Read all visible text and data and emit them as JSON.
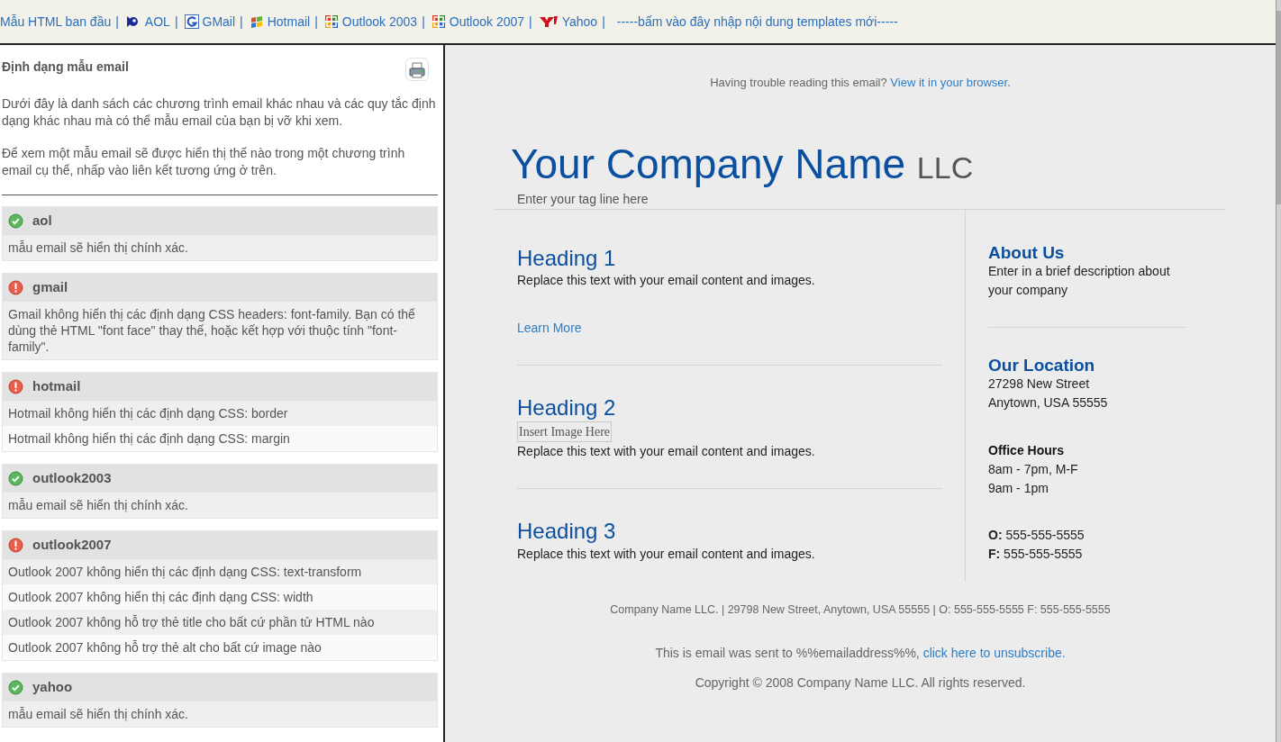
{
  "nav_links": [
    {
      "label": "Mẫu HTML ban đầu",
      "kind": "none",
      "separator": "|"
    },
    {
      "label": "AOL",
      "kind": "aol",
      "separator": "|"
    },
    {
      "label": "GMail",
      "kind": "gmail",
      "separator": "|"
    },
    {
      "label": "Hotmail",
      "kind": "windows",
      "separator": "|"
    },
    {
      "label": "Outlook 2003",
      "kind": "office",
      "separator": "|"
    },
    {
      "label": "Outlook 2007",
      "kind": "office",
      "separator": "|"
    },
    {
      "label": "Yahoo",
      "kind": "yahoo",
      "separator": "|"
    },
    {
      "label": "-----bấm vào đây nhập nội dung templates mới-----",
      "kind": "none"
    }
  ],
  "panel": {
    "title": "Định dạng mẫu email",
    "paragraphs": [
      "Dưới đây là danh sách các chương trình email khác nhau và các quy tắc định dạng khác nhau mà có thể mẫu email của bạn bị vỡ khi xem.",
      "Để xem một mẫu email sẽ được hiển thị thế nào trong một chương trình email cụ thể, nhấp vào liên kết tương ứng ở trên."
    ],
    "clients": [
      {
        "name": "aol",
        "passed": true,
        "notes": [
          "mẫu email sẽ hiển thị chính xác."
        ]
      },
      {
        "name": "gmail",
        "passed": false,
        "notes": [
          "Gmail không hiển thị các định dạng CSS headers: font-family. Bạn có thể dùng thẻ HTML \"font face\" thay thế, hoặc kết hợp với thuộc tính \"font-family\"."
        ]
      },
      {
        "name": "hotmail",
        "passed": false,
        "notes": [
          "Hotmail không hiển thị các định dạng CSS: border",
          "Hotmail không hiển thị các định dạng CSS: margin"
        ]
      },
      {
        "name": "outlook2003",
        "passed": true,
        "notes": [
          "mẫu email sẽ hiển thị chính xác."
        ]
      },
      {
        "name": "outlook2007",
        "passed": false,
        "notes": [
          "Outlook 2007 không hiển thị các định dạng CSS: text-transform",
          "Outlook 2007 không hiển thị các định dạng CSS: width",
          "Outlook 2007 không hỗ trợ thẻ title cho bất cứ phần tử HTML nào",
          "Outlook 2007 không hỗ trợ thẻ alt cho bất cứ image nào"
        ]
      },
      {
        "name": "yahoo",
        "passed": true,
        "notes": [
          "mẫu email sẽ hiển thị chính xác."
        ]
      }
    ]
  },
  "email": {
    "preheader": {
      "text": "Having trouble reading this email?",
      "link": "View it in your browser."
    },
    "company": {
      "name": "Your Company Name",
      "suffix": "LLC",
      "tagline": "Enter your tag line here"
    },
    "sections": [
      {
        "heading": "Heading 1",
        "text": "Replace this text with your email content and images.",
        "link": "Learn More"
      },
      {
        "heading": "Heading 2",
        "image_placeholder": "Insert Image Here",
        "text": "Replace this text with your email content and images."
      },
      {
        "heading": "Heading 3",
        "text": "Replace this text with your email content and images."
      }
    ],
    "about": {
      "heading": "About Us",
      "text": "Enter in a brief description about your company"
    },
    "location": {
      "heading": "Our Location",
      "lines": [
        "27298 New Street",
        "Anytown, USA 55555"
      ]
    },
    "hours": {
      "heading": "Office Hours",
      "lines": [
        "8am - 7pm, M-F",
        "9am - 1pm"
      ]
    },
    "contacts": [
      {
        "label": "O:",
        "value": "555-555-5555"
      },
      {
        "label": "F:",
        "value": "555-555-5555"
      }
    ],
    "footer": {
      "address": "Company Name LLC. | 29798 New Street, Anytown, USA 55555 | O: 555-555-5555 F: 555-555-5555",
      "unsubscribe_text": "This is email was sent to %%emailaddress%%,",
      "unsubscribe_link": "click here to unsubscribe.",
      "copyright": "Copyright © 2008 Company Name LLC. All rights reserved."
    }
  }
}
